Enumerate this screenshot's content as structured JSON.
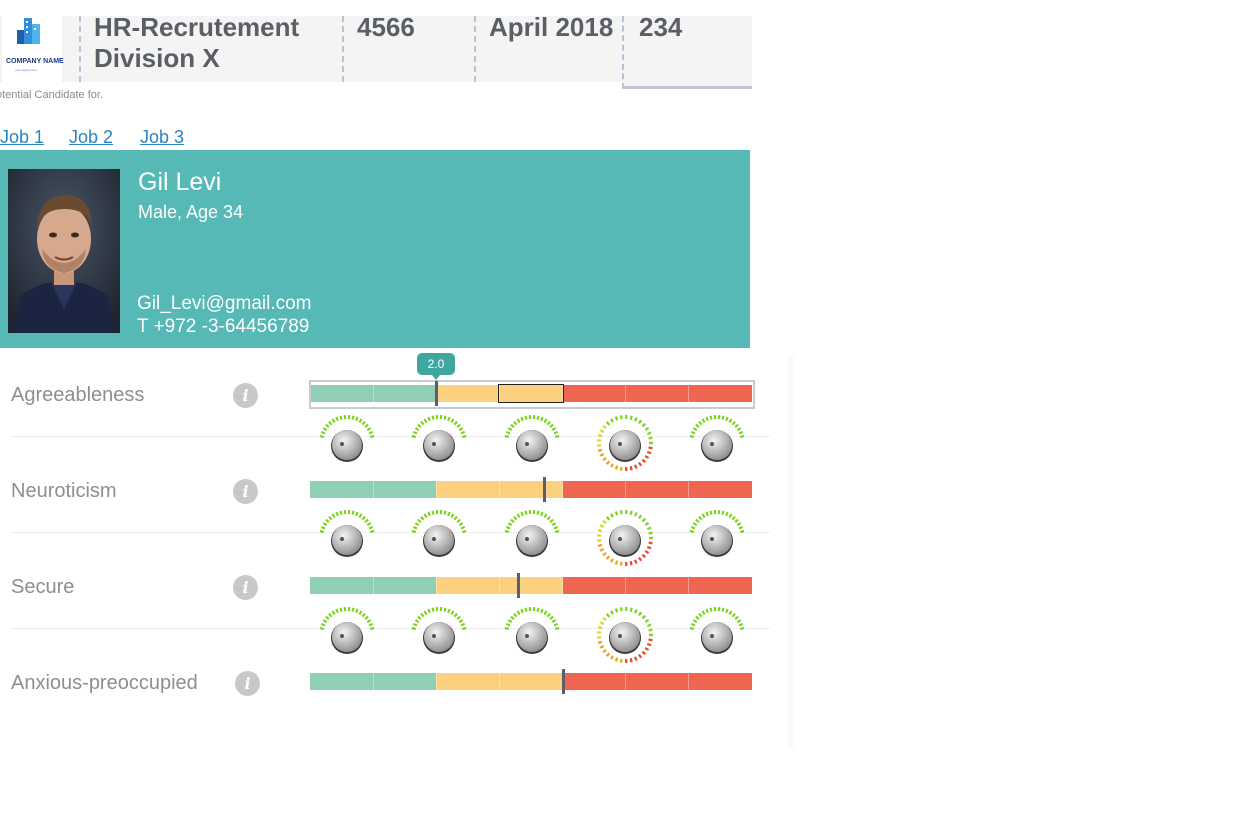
{
  "header": {
    "logo": {
      "company": "COMPANY NAME",
      "tagline": "your tagline here",
      "icon": "building-logo-icon"
    },
    "title": "HR-Recrutement Division X",
    "number": "4566",
    "date": "April 2018",
    "count": "234"
  },
  "note": "otential Candidate for.",
  "jobs": [
    "Job 1",
    "Job 2",
    "Job 3"
  ],
  "candidate": {
    "name": "Gil Levi",
    "meta": "Male, Age 34",
    "email": "Gil_Levi@gmail.com",
    "phone": "T  +972 -3-64456789",
    "photo": "candidate-portrait"
  },
  "colors": {
    "card": "#56b9b5",
    "green": "#8fcfb5",
    "yellow": "#fbd07f",
    "red": "#ee6652",
    "link": "#2a85c2"
  },
  "traits": [
    {
      "label": "Agreeableness",
      "score": 2.0,
      "score_label": "2.0",
      "icon": "info-icon"
    },
    {
      "label": "Neuroticism",
      "score": 3.7,
      "icon": "info-icon"
    },
    {
      "label": "Secure",
      "score": 3.3,
      "icon": "info-icon"
    },
    {
      "label": "Anxious-preoccupied",
      "score": 4.0,
      "icon": "info-icon"
    }
  ],
  "scale": {
    "min": 0,
    "max": 7,
    "zones": [
      "green",
      "yellow",
      "red"
    ]
  }
}
